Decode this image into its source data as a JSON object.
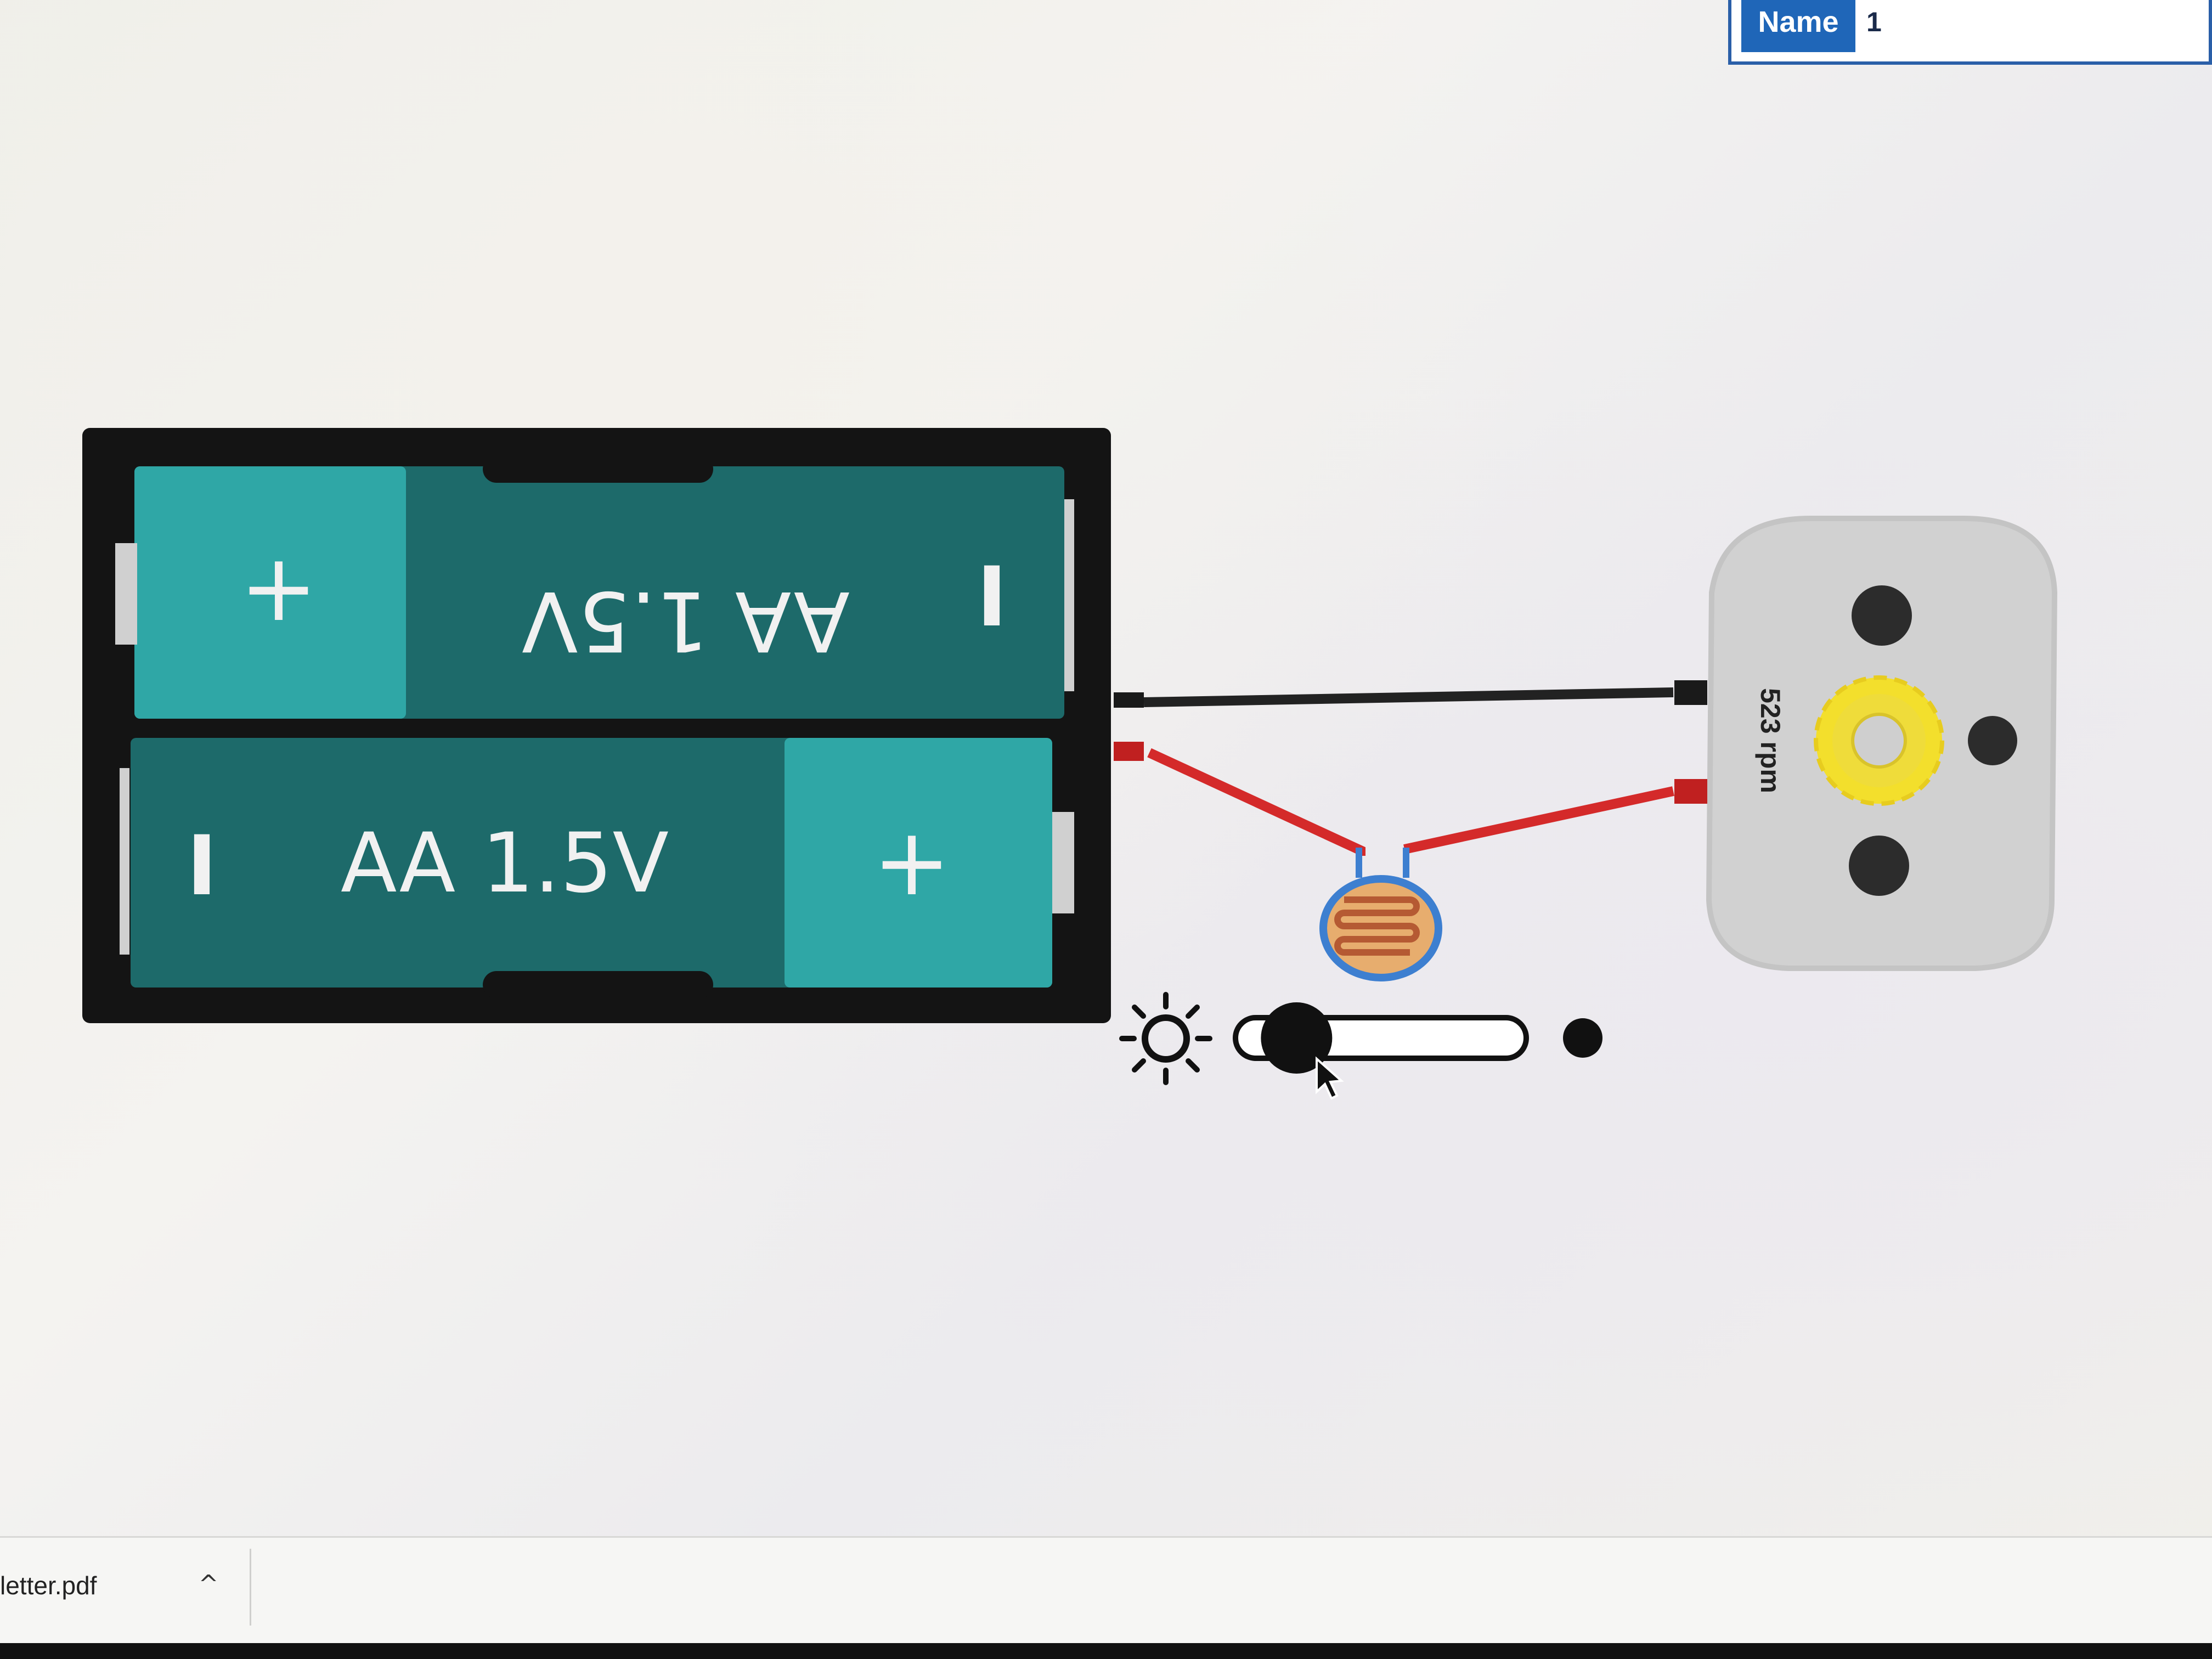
{
  "properties": {
    "name_label": "Name",
    "name_value": "1"
  },
  "battery_holder": {
    "cells": [
      {
        "label": "AA 1.5V",
        "orientation": "upside-down",
        "plus_symbol": "+",
        "minus_symbol": "I"
      },
      {
        "label": "AA 1.5V",
        "orientation": "normal",
        "plus_symbol": "+",
        "minus_symbol": "I"
      }
    ]
  },
  "motor": {
    "speed": "523 rpm"
  },
  "light_slider": {
    "level_fraction": 0.15,
    "icon": "sun-icon",
    "end_icon": "dot-icon"
  },
  "downloads": {
    "file_name": "letter.pdf",
    "chevron": "^"
  },
  "colors": {
    "cell_dark": "#1d6a6a",
    "cell_plus": "#2fa7a6",
    "holder": "#141414",
    "wire_red": "#d42a2a",
    "wire_black": "#222222",
    "gear": "#f3df2c",
    "motor_body": "#cfcfcf"
  }
}
